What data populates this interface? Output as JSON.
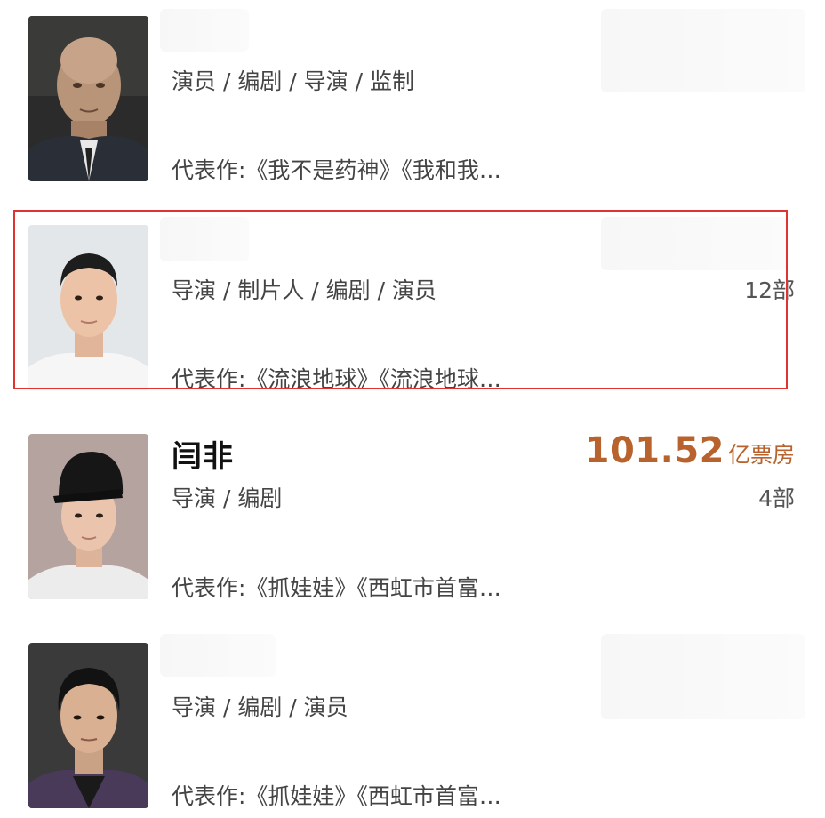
{
  "people": [
    {
      "name": "",
      "roles": "演员 / 编剧 / 导演 / 监制",
      "works": "代表作:《我不是药神》《我和我…",
      "count": "",
      "box_office_value": "",
      "box_office_unit": "",
      "avatar_icon": "bald-man-portrait"
    },
    {
      "name": "",
      "roles": "导演 / 制片人 / 编剧 / 演员",
      "works": "代表作:《流浪地球》《流浪地球…",
      "count": "12部",
      "box_office_value": "",
      "box_office_unit": "",
      "avatar_icon": "man-portrait",
      "highlighted": true
    },
    {
      "name": "闫非",
      "roles": "导演 / 编剧",
      "works": "代表作:《抓娃娃》《西虹市首富…",
      "count": "4部",
      "box_office_value": "101.52",
      "box_office_unit": "亿票房",
      "avatar_icon": "man-in-cap-portrait"
    },
    {
      "name": "",
      "roles": "导演 / 编剧 / 演员",
      "works": "代表作:《抓娃娃》《西虹市首富…",
      "count": "",
      "box_office_value": "",
      "box_office_unit": "",
      "avatar_icon": "man-portrait"
    }
  ],
  "colors": {
    "box_office": "#b8632e",
    "highlight_border": "#e0322f",
    "text": "#444444",
    "name": "#111111"
  }
}
